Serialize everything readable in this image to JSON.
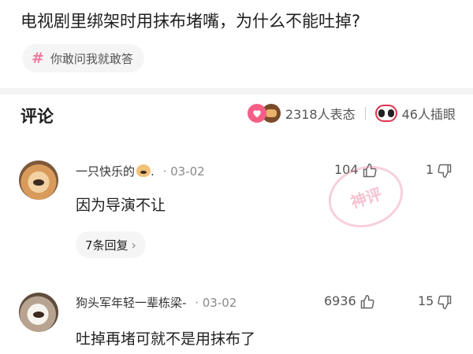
{
  "question": {
    "title": "电视剧里绑架时用抹布堵嘴，为什么不能吐掉?",
    "topic_tag": "你敢问我就敢答"
  },
  "comments_section": {
    "title": "评论",
    "reactions_count": "2318人表态",
    "inserted_eyes_count": "46人插眼"
  },
  "comments": [
    {
      "username": "一只快乐的",
      "username_suffix": ".",
      "date": "03-02",
      "likes": "104",
      "dislikes": "1",
      "text": "因为导演不让",
      "replies_label": "7条回复",
      "badge": "神评"
    },
    {
      "username": "狗头军年轻一辈栋梁-",
      "date": "03-02",
      "likes": "6936",
      "dislikes": "15",
      "text": "吐掉再堵可就不是用抹布了"
    }
  ],
  "colors": {
    "accent_pink": "#f55f85",
    "muted_text": "#8a8a8a",
    "tag_bg": "#f5f5f5"
  },
  "icons": {
    "topic": "hash-icon",
    "like": "thumbs-up-icon",
    "dislike": "thumbs-down-icon",
    "reaction": "emoji-reaction-icon",
    "eyes": "eyes-icon"
  }
}
